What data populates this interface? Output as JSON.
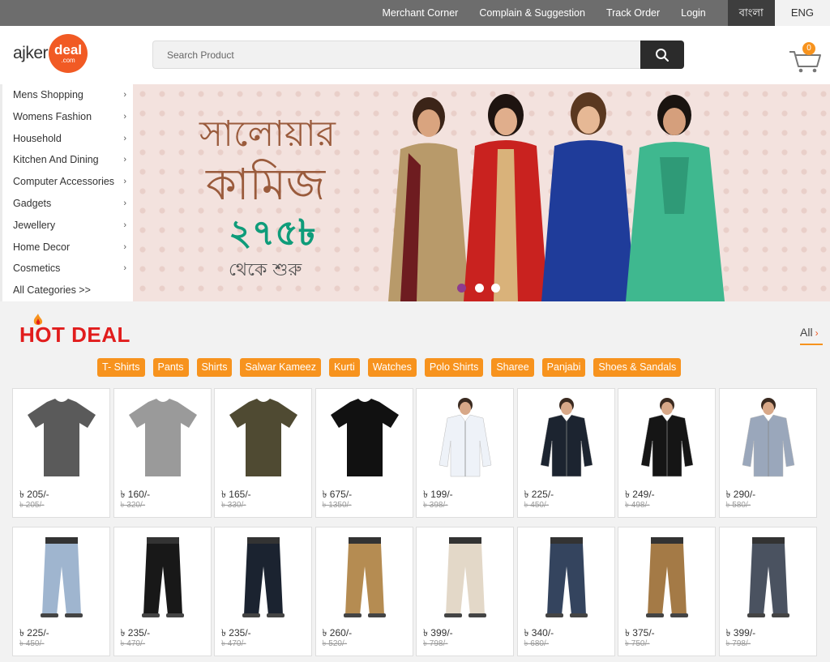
{
  "topbar": {
    "links": [
      "Merchant Corner",
      "Complain & Suggestion",
      "Track Order",
      "Login"
    ],
    "lang_bn": "বাংলা",
    "lang_en": "ENG"
  },
  "header": {
    "logo_word": "ajker",
    "logo_badge": "deal",
    "logo_badge_sub": ".com",
    "search_placeholder": "Search Product",
    "cart_count": "0"
  },
  "sidebar": {
    "items": [
      {
        "label": "Mens Shopping"
      },
      {
        "label": "Womens Fashion"
      },
      {
        "label": "Household"
      },
      {
        "label": "Kitchen And Dining"
      },
      {
        "label": "Computer Accessories"
      },
      {
        "label": "Gadgets"
      },
      {
        "label": "Jewellery"
      },
      {
        "label": "Home Decor"
      },
      {
        "label": "Cosmetics"
      }
    ],
    "all_categories": "All Categories >>"
  },
  "banner": {
    "line1": "সালোয়ার",
    "line2": "কামিজ",
    "price": "২৭৫৳",
    "line4": "থেকে শুরু",
    "active_slide": 1,
    "slide_count": 3
  },
  "hot_deal": {
    "title": "HOT DEAL",
    "all_label": "All",
    "categories": [
      "T- Shirts",
      "Pants",
      "Shirts",
      "Salwar Kameez",
      "Kurti",
      "Watches",
      "Polo Shirts",
      "Sharee",
      "Panjabi",
      "Shoes & Sandals"
    ]
  },
  "products": [
    {
      "price": "৳ 205/-",
      "old": "৳ 205/-",
      "kind": "tshirt",
      "color": "#5a5a5a"
    },
    {
      "price": "৳ 160/-",
      "old": "৳ 320/-",
      "kind": "tshirt",
      "color": "#9a9a9a"
    },
    {
      "price": "৳ 165/-",
      "old": "৳ 330/-",
      "kind": "tshirt",
      "color": "#4f4a32"
    },
    {
      "price": "৳ 675/-",
      "old": "৳ 1350/-",
      "kind": "tshirt",
      "color": "#111111"
    },
    {
      "price": "৳ 199/-",
      "old": "৳ 398/-",
      "kind": "shirt",
      "color": "#eef2f8"
    },
    {
      "price": "৳ 225/-",
      "old": "৳ 450/-",
      "kind": "shirt",
      "color": "#1c2430"
    },
    {
      "price": "৳ 249/-",
      "old": "৳ 498/-",
      "kind": "shirt",
      "color": "#151515"
    },
    {
      "price": "৳ 290/-",
      "old": "৳ 580/-",
      "kind": "shirt",
      "color": "#9aa7bb"
    },
    {
      "price": "৳ 225/-",
      "old": "৳ 450/-",
      "kind": "pants",
      "color": "#9fb5cf"
    },
    {
      "price": "৳ 235/-",
      "old": "৳ 470/-",
      "kind": "pants",
      "color": "#181818"
    },
    {
      "price": "৳ 235/-",
      "old": "৳ 470/-",
      "kind": "pants",
      "color": "#1b2330"
    },
    {
      "price": "৳ 260/-",
      "old": "৳ 520/-",
      "kind": "pants",
      "color": "#b58c52"
    },
    {
      "price": "৳ 399/-",
      "old": "৳ 798/-",
      "kind": "pants",
      "color": "#e3d8c8"
    },
    {
      "price": "৳ 340/-",
      "old": "৳ 680/-",
      "kind": "pants",
      "color": "#34445e"
    },
    {
      "price": "৳ 375/-",
      "old": "৳ 750/-",
      "kind": "pants",
      "color": "#a47a46"
    },
    {
      "price": "৳ 399/-",
      "old": "৳ 798/-",
      "kind": "pants",
      "color": "#4a5260"
    }
  ]
}
